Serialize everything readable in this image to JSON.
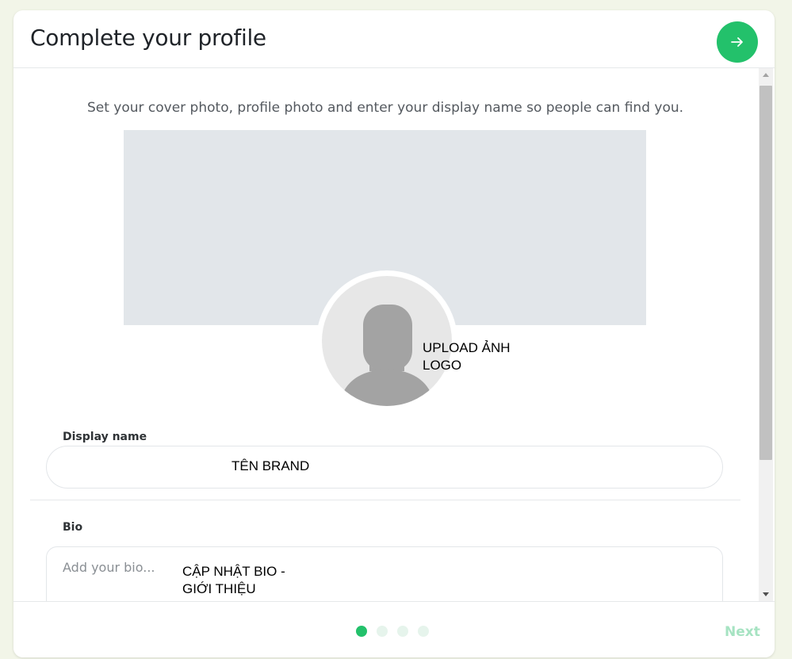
{
  "header": {
    "title": "Complete your profile",
    "next_icon": "arrow-right-icon",
    "accent_color": "#23c16b"
  },
  "intro": "Set your cover photo, profile photo and enter your display name so people can find you.",
  "avatar": {
    "icon": "user-silhouette-icon",
    "overlay_line1": "UPLOAD ẢNH",
    "overlay_line2": "LOGO"
  },
  "display_name": {
    "label": "Display name",
    "value": "TÊN BRAND"
  },
  "bio": {
    "label": "Bio",
    "placeholder": "Add your bio...",
    "value_line1": "CẬP NHẬT BIO -",
    "value_line2": "GIỚI THIỆU"
  },
  "footer": {
    "steps_total": 4,
    "current_step": 1,
    "next_label": "Next"
  }
}
